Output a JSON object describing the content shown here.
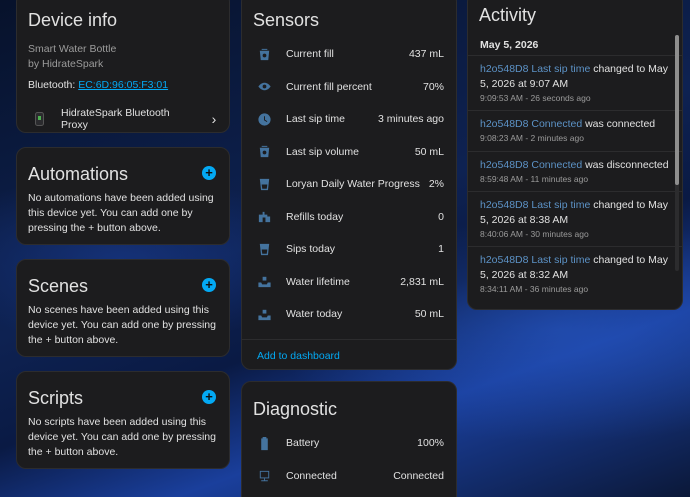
{
  "device_info": {
    "title": "Device info",
    "model": "Smart Water Bottle",
    "manufacturer": "by HidrateSpark",
    "bluetooth_label": "Bluetooth:",
    "bluetooth_address": "EC:6D:96:05:F3:01",
    "proxy_name": "HidrateSpark Bluetooth Proxy"
  },
  "automations": {
    "title": "Automations",
    "text": "No automations have been added using this device yet. You can add one by pressing the + button above."
  },
  "scenes": {
    "title": "Scenes",
    "text": "No scenes have been added using this device yet. You can add one by pressing the + button above."
  },
  "scripts": {
    "title": "Scripts",
    "text": "No scripts have been added using this device yet. You can add one by pressing the + button above."
  },
  "sensors": {
    "title": "Sensors",
    "add_to_dashboard": "Add to dashboard",
    "rows": [
      {
        "icon": "cup-water-icon",
        "label": "Current fill",
        "value": "437 mL"
      },
      {
        "icon": "eye-icon",
        "label": "Current fill percent",
        "value": "70%"
      },
      {
        "icon": "clock-icon",
        "label": "Last sip time",
        "value": "3 minutes ago"
      },
      {
        "icon": "cup-water-icon",
        "label": "Last sip volume",
        "value": "50 mL"
      },
      {
        "icon": "cup-icon",
        "label": "Loryan Daily Water Progress",
        "value": "2%"
      },
      {
        "icon": "water-pump-icon",
        "label": "Refills today",
        "value": "0"
      },
      {
        "icon": "cup-icon",
        "label": "Sips today",
        "value": "1"
      },
      {
        "icon": "tray-icon",
        "label": "Water lifetime",
        "value": "2,831 mL"
      },
      {
        "icon": "tray-icon",
        "label": "Water today",
        "value": "50 mL"
      }
    ]
  },
  "diagnostic": {
    "title": "Diagnostic",
    "rows": [
      {
        "icon": "battery-icon",
        "label": "Battery",
        "value": "100%"
      },
      {
        "icon": "lan-connect-icon",
        "label": "Connected",
        "value": "Connected"
      }
    ]
  },
  "activity": {
    "title": "Activity",
    "date": "May 5, 2026",
    "items": [
      {
        "entity": "h2o548D8 Last sip time",
        "text": " changed to May 5, 2026 at 9:07 AM",
        "time": "9:09:53 AM - 26 seconds ago"
      },
      {
        "entity": "h2o548D8 Connected",
        "text": " was connected",
        "time": "9:08:23 AM - 2 minutes ago"
      },
      {
        "entity": "h2o548D8 Connected",
        "text": " was disconnected",
        "time": "8:59:48 AM - 11 minutes ago"
      },
      {
        "entity": "h2o548D8 Last sip time",
        "text": " changed to May 5, 2026 at 8:38 AM",
        "time": "8:40:06 AM - 30 minutes ago"
      },
      {
        "entity": "h2o548D8 Last sip time",
        "text": " changed to May 5, 2026 at 8:32 AM",
        "time": "8:34:11 AM - 36 minutes ago"
      }
    ]
  },
  "colors": {
    "card_bg": "#1c1c1e",
    "accent": "#03a9f4",
    "icon": "#44739e",
    "link": "#5c92c6"
  }
}
